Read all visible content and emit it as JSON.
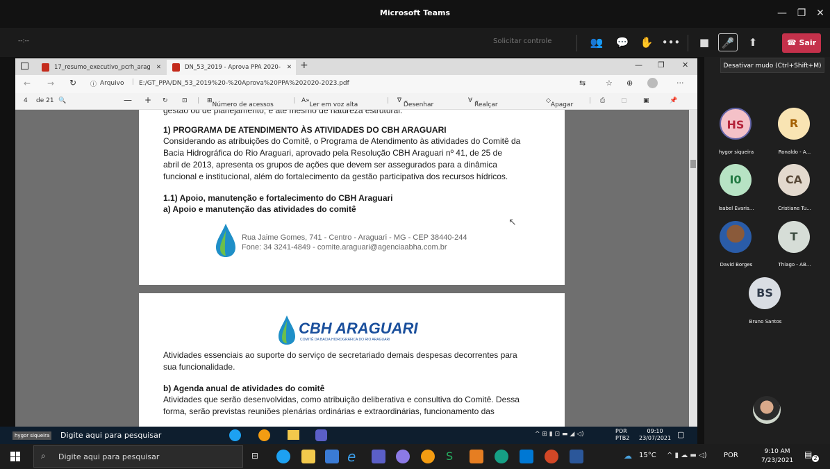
{
  "window": {
    "title": "Microsoft Teams"
  },
  "callbar": {
    "left_text": "--:--",
    "request_control": "Solicitar controle",
    "leave": "Sair"
  },
  "tooltip": "Desativar mudo (Ctrl+Shift+M)",
  "browser": {
    "tabs": [
      {
        "label": "17_resumo_executivo_pcrh_arag"
      },
      {
        "label": "DN_53_2019 - Aprova PPA 2020-"
      }
    ],
    "address_prefix": "Arquivo",
    "address": "E:/GT_PPA/DN_53_2019%20-%20Aprova%20PPA%202020-2023.pdf"
  },
  "pdf_toolbar": {
    "page": "4",
    "page_total": "de 21",
    "access": "Número de acessos",
    "read": "Ler em voz alta",
    "draw": "Desenhar",
    "highlight": "Realçar",
    "erase": "Apagar"
  },
  "doc": {
    "top_cut": "gestão ou de planejamento, e até mesmo de natureza estrutural.",
    "h1": "1) PROGRAMA DE ATENDIMENTO ÀS ATIVIDADES DO CBH ARAGUARI",
    "p1": [
      "Considerando as atribuições do Comitê, o Programa de Atendimento às atividades do Comitê da",
      "Bacia Hidrográfica do Rio Araguari, aprovado pela Resolução CBH Araguari nº 41, de 25 de",
      "abril de 2013, apresenta os grupos de ações que devem ser assegurados para a dinâmica",
      "funcional e institucional, além do fortalecimento da gestão participativa dos recursos hídricos."
    ],
    "h2": "1.1) Apoio, manutenção e fortalecimento do CBH Araguari",
    "h3": "a) Apoio e manutenção das atividades do comitê",
    "footer1": "Rua Jaime Gomes, 741 - Centro - Araguari - MG - CEP 38440-244",
    "footer2": "Fone: 34 3241-4849 - comite.araguari@agenciaabha.com.br",
    "logo": "CBH ARAGUARI",
    "logo_sub": "COMITÊ DA BACIA HIDROGRÁFICA DO RIO ARAGUARI",
    "p2": [
      "Atividades essenciais ao suporte do serviço de secretariado demais despesas decorrentes para",
      "sua funcionalidade."
    ],
    "h4": "b) Agenda anual de atividades do comitê",
    "p3": [
      "Atividades que serão desenvolvidas, como atribuição deliberativa e consultiva do Comitê. Dessa",
      "forma, serão previstas reuniões plenárias ordinárias e extraordinárias, funcionamento das"
    ]
  },
  "inner_taskbar": {
    "presenter": "hygor siqueira",
    "search": "Digite aqui para pesquisar",
    "lang1": "POR",
    "lang2": "PTB2",
    "time": "09:10",
    "date": "23/07/2021"
  },
  "participants": [
    {
      "initials": "HS",
      "name": "hygor siqueira",
      "bg": "#f4c1c8",
      "fg": "#b4233a"
    },
    {
      "initials": "R",
      "name": "Ronaldo - A...",
      "bg": "#f9e4b3",
      "fg": "#a45f00"
    },
    {
      "initials": "I0",
      "name": "Isabel Evaris...",
      "bg": "#b7e3c4",
      "fg": "#237b43"
    },
    {
      "initials": "CA",
      "name": "Cristiane Tu...",
      "bg": "#e3d9ce",
      "fg": "#5a4a3a"
    },
    {
      "initials": "",
      "name": "David Borges",
      "bg": "#3a2a1a",
      "fg": "#fff"
    },
    {
      "initials": "T",
      "name": "Thiago - AB...",
      "bg": "#d6ddd7",
      "fg": "#3c4b40"
    },
    {
      "initials": "BS",
      "name": "Bruno Santos",
      "bg": "#d9dde3",
      "fg": "#2f3a4a"
    }
  ],
  "taskbar": {
    "search": "Digite aqui para pesquisar",
    "temp": "15°C",
    "lang": "POR",
    "time": "9:10 AM",
    "date": "7/23/2021",
    "notif": "2"
  }
}
